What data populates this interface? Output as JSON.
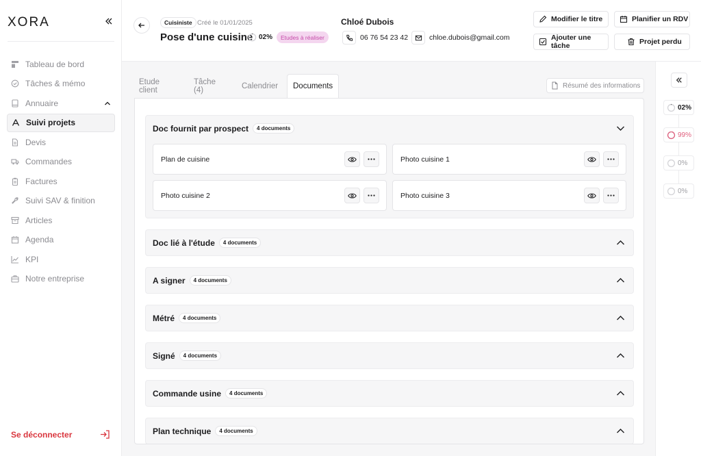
{
  "sidebar": {
    "logo": "XORA",
    "items": [
      {
        "label": "Tableau de bord",
        "icon": "dashboard-icon"
      },
      {
        "label": "Tâches & mémo",
        "icon": "check-circle-icon"
      },
      {
        "label": "Annuaire",
        "icon": "book-icon"
      },
      {
        "label": "Suivi projets",
        "icon": "person-icon"
      },
      {
        "label": "Devis",
        "icon": "document-icon"
      },
      {
        "label": "Commandes",
        "icon": "truck-icon"
      },
      {
        "label": "Factures",
        "icon": "clipboard-icon"
      },
      {
        "label": "Suivi SAV & finition",
        "icon": "wrench-icon"
      },
      {
        "label": "Articles",
        "icon": "archive-icon"
      },
      {
        "label": "Agenda",
        "icon": "calendar-icon"
      },
      {
        "label": "KPI",
        "icon": "chart-line-icon"
      },
      {
        "label": "Notre entreprise",
        "icon": "briefcase-icon"
      }
    ],
    "active_index": 3,
    "logout": "Se déconnecter"
  },
  "header": {
    "type_badge": "Cuisiniste",
    "created": "Créé le 01/01/2025",
    "title": "Pose d'une cuisine",
    "progress": "02%",
    "progress_value": 0.02,
    "status": "Etudes à réaliser",
    "client_name": "Chloé Dubois",
    "phone": "06 76 54 23 42",
    "email": "chloe.dubois@gmail.com",
    "buttons": {
      "edit_title": "Modifier le titre",
      "schedule": "Planifier un RDV",
      "add_task": "Ajouter une tâche",
      "lost": "Projet perdu"
    }
  },
  "tabs": [
    "Etude client",
    "Tâche (4)",
    "Calendrier",
    "Documents"
  ],
  "active_tab": 3,
  "resume_button": "Résumé des informations",
  "sections": [
    {
      "title": "Doc fournit par prospect",
      "count": "4 documents",
      "expanded": true,
      "docs": [
        "Plan de cuisine",
        "Photo cuisine 1",
        "Photo cuisine 2",
        "Photo cuisine 3"
      ]
    },
    {
      "title": "Doc lié à l'étude",
      "count": "4 documents",
      "expanded": false
    },
    {
      "title": "A signer",
      "count": "4 documents",
      "expanded": false
    },
    {
      "title": "Métré",
      "count": "4 documents",
      "expanded": false
    },
    {
      "title": "Signé",
      "count": "4 documents",
      "expanded": false
    },
    {
      "title": "Commande usine",
      "count": "4 documents",
      "expanded": false
    },
    {
      "title": "Plan technique",
      "count": "4 documents",
      "expanded": false
    }
  ],
  "rail": [
    {
      "label": "02%",
      "value": 0.02,
      "color": "#1c1c1e"
    },
    {
      "label": "99%",
      "value": 0.99,
      "color": "#e0607e"
    },
    {
      "label": "0%",
      "value": 0,
      "color": "#a0a0a5"
    },
    {
      "label": "0%",
      "value": 0,
      "color": "#a0a0a5"
    }
  ]
}
